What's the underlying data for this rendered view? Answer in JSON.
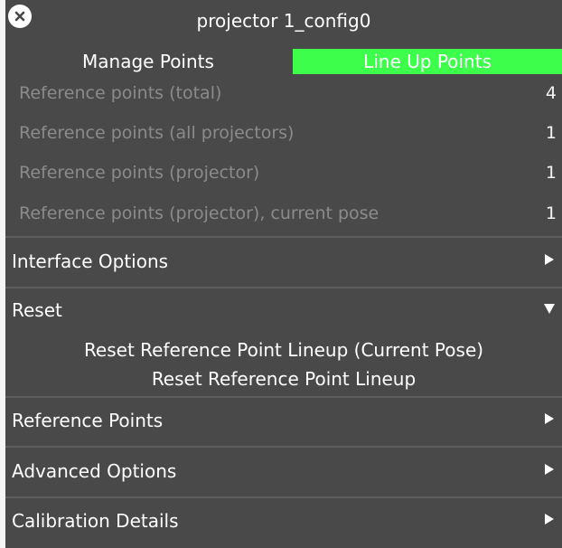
{
  "window": {
    "title": "projector 1_config0"
  },
  "tabs": {
    "manage_points": "Manage Points",
    "line_up_points": "Line Up Points",
    "active_color": "#3dff4b"
  },
  "stats": [
    {
      "label": "Reference points (total)",
      "value": "4"
    },
    {
      "label": "Reference points (all projectors)",
      "value": "1"
    },
    {
      "label": "Reference points (projector)",
      "value": "1"
    },
    {
      "label": "Reference points (projector), current pose",
      "value": "1"
    }
  ],
  "sections": {
    "interface_options": {
      "label": "Interface Options",
      "icon": "triangle-right-icon"
    },
    "reset": {
      "label": "Reset",
      "icon": "triangle-down-icon"
    },
    "reference_points": {
      "label": "Reference Points",
      "icon": "triangle-right-icon"
    },
    "advanced_options": {
      "label": "Advanced Options",
      "icon": "triangle-right-icon"
    },
    "calibration_details": {
      "label": "Calibration Details",
      "icon": "triangle-right-icon"
    }
  },
  "reset_actions": {
    "reset_current_pose": "Reset Reference Point Lineup (Current Pose)",
    "reset_lineup": "Reset Reference Point Lineup"
  }
}
